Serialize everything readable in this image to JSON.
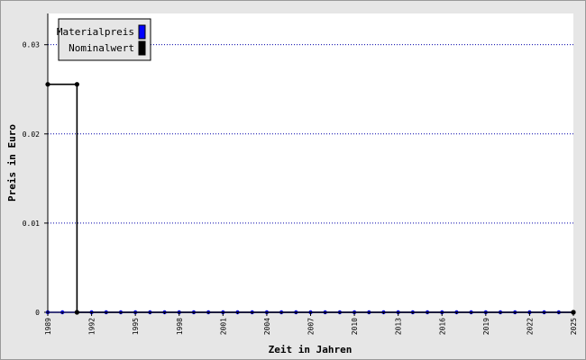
{
  "chart_data": {
    "type": "line",
    "xlabel": "Zeit in Jahren",
    "ylabel": "Preis in Euro",
    "ylim": [
      0,
      0.0335
    ],
    "xlim": [
      1989,
      2025
    ],
    "yticks": [
      0,
      0.01,
      0.02,
      0.03
    ],
    "ytick_labels": [
      "0",
      "0.01",
      "0.02",
      "0.03"
    ],
    "xticks": [
      1989,
      1992,
      1995,
      1998,
      2001,
      2004,
      2007,
      2010,
      2013,
      2016,
      2019,
      2022,
      2025
    ],
    "grid": "horizontal dotted",
    "legend_position": "top-left",
    "series": [
      {
        "name": "Materialpreis",
        "color": "#0000ff",
        "step": false,
        "x": [
          1989,
          1990,
          1991,
          1992,
          1993,
          1994,
          1995,
          1996,
          1997,
          1998,
          1999,
          2000,
          2001,
          2002,
          2003,
          2004,
          2005,
          2006,
          2007,
          2008,
          2009,
          2010,
          2011,
          2012,
          2013,
          2014,
          2015,
          2016,
          2017,
          2018,
          2019,
          2020,
          2021,
          2022,
          2023,
          2024,
          2025
        ],
        "values": [
          0,
          0,
          0,
          0,
          0,
          0,
          0,
          0,
          0,
          0,
          0,
          0,
          0,
          0,
          0,
          0,
          0,
          0,
          0,
          0,
          0,
          0,
          0,
          0,
          0,
          0,
          0,
          0,
          0,
          0,
          0,
          0,
          0,
          0,
          0,
          0,
          0
        ]
      },
      {
        "name": "Nominalwert",
        "color": "#000000",
        "step": true,
        "x": [
          1989,
          1991,
          2025
        ],
        "values": [
          0.02556,
          0,
          0
        ]
      }
    ]
  }
}
